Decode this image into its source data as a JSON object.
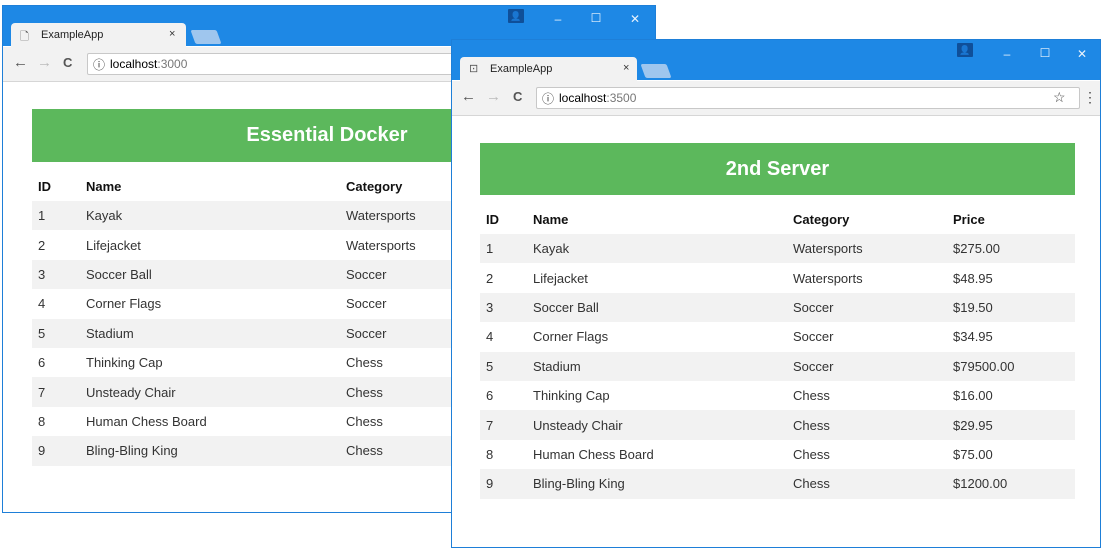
{
  "window1": {
    "tab_title": "ExampleApp",
    "tab_close": "×",
    "address": {
      "info_icon": "ⓘ",
      "host": "localhost",
      "port": ":3000"
    },
    "heading": "Essential Docker",
    "columns": [
      "ID",
      "Name",
      "Category"
    ],
    "rows": [
      [
        "1",
        "Kayak",
        "Watersports"
      ],
      [
        "2",
        "Lifejacket",
        "Watersports"
      ],
      [
        "3",
        "Soccer Ball",
        "Soccer"
      ],
      [
        "4",
        "Corner Flags",
        "Soccer"
      ],
      [
        "5",
        "Stadium",
        "Soccer"
      ],
      [
        "6",
        "Thinking Cap",
        "Chess"
      ],
      [
        "7",
        "Unsteady Chair",
        "Chess"
      ],
      [
        "8",
        "Human Chess Board",
        "Chess"
      ],
      [
        "9",
        "Bling-Bling King",
        "Chess"
      ]
    ]
  },
  "window2": {
    "tab_title": "ExampleApp",
    "tab_close": "×",
    "address": {
      "info_icon": "ⓘ",
      "host": "localhost",
      "port": ":3500"
    },
    "heading": "2nd Server",
    "columns": [
      "ID",
      "Name",
      "Category",
      "Price"
    ],
    "rows": [
      [
        "1",
        "Kayak",
        "Watersports",
        "$275.00"
      ],
      [
        "2",
        "Lifejacket",
        "Watersports",
        "$48.95"
      ],
      [
        "3",
        "Soccer Ball",
        "Soccer",
        "$19.50"
      ],
      [
        "4",
        "Corner Flags",
        "Soccer",
        "$34.95"
      ],
      [
        "5",
        "Stadium",
        "Soccer",
        "$79500.00"
      ],
      [
        "6",
        "Thinking Cap",
        "Chess",
        "$16.00"
      ],
      [
        "7",
        "Unsteady Chair",
        "Chess",
        "$29.95"
      ],
      [
        "8",
        "Human Chess Board",
        "Chess",
        "$75.00"
      ],
      [
        "9",
        "Bling-Bling King",
        "Chess",
        "$1200.00"
      ]
    ]
  },
  "controls": {
    "minimize": "–",
    "maximize": "☐",
    "close": "✕",
    "back": "←",
    "forward": "→",
    "reload": "C",
    "star": "☆",
    "menu": "⋮"
  },
  "colors": {
    "titlebar": "#1e88e5",
    "heading_bg": "#5cb85c",
    "stripe": "#f2f2f2"
  }
}
